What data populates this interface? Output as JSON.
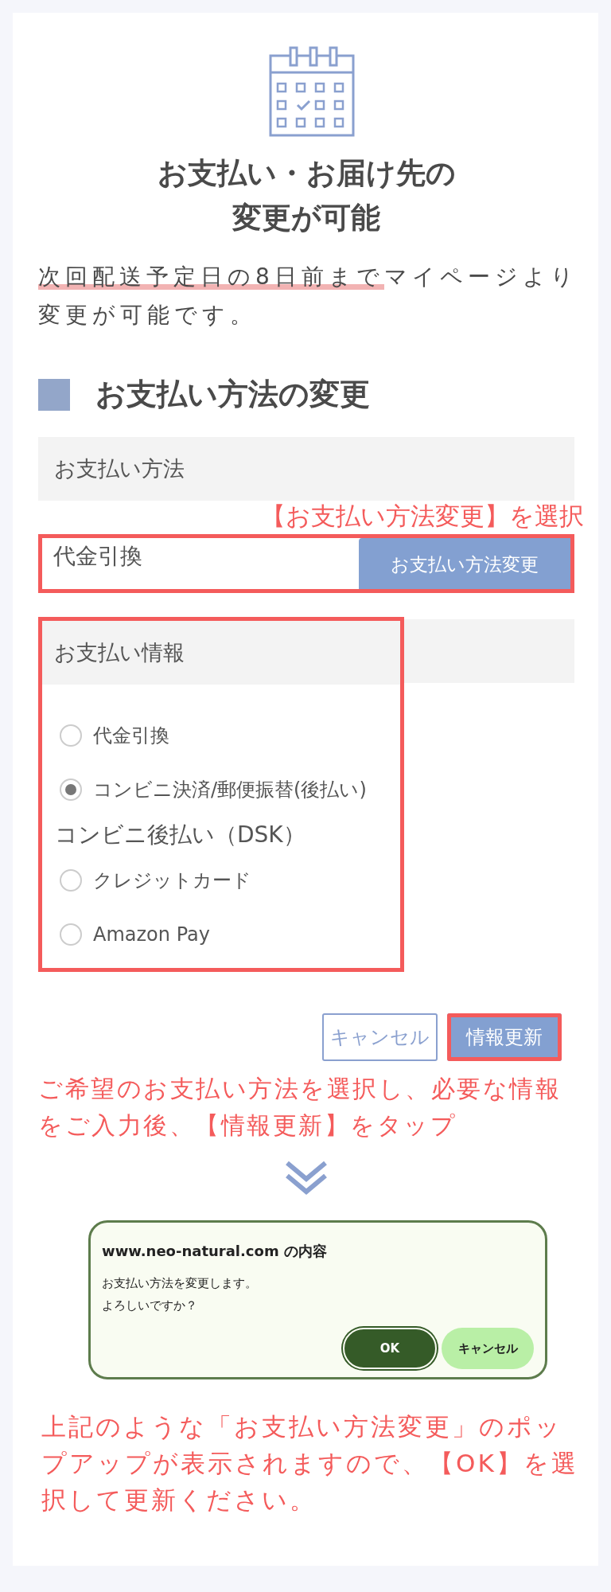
{
  "title_lines": [
    "お支払い・お届け先の",
    "変更が可能"
  ],
  "note": {
    "marked": "次回配送予定日の8日前まで",
    "rest": "マイページより変更が可能です。"
  },
  "section_heading": "お支払い方法の変更",
  "method": {
    "label": "お支払い方法",
    "annotation": "【お支払い方法変更】を選択",
    "value": "代金引換",
    "button": "お支払い方法変更",
    "highlighted": true
  },
  "payment_info": {
    "label": "お支払い情報",
    "highlighted": true,
    "options": [
      {
        "kind": "radio",
        "label": "代金引換",
        "selected": false
      },
      {
        "kind": "radio",
        "label": "コンビニ決済/郵便振替(後払い)",
        "selected": true
      },
      {
        "kind": "heading",
        "label": "コンビニ後払い（DSK）"
      },
      {
        "kind": "radio",
        "label": "クレジットカード",
        "selected": false
      },
      {
        "kind": "radio",
        "label": "Amazon Pay",
        "selected": false
      }
    ]
  },
  "actions": [
    {
      "kind": "outline",
      "label": "キャンセル",
      "highlighted": false
    },
    {
      "kind": "solid",
      "label": "情報更新",
      "highlighted": true
    }
  ],
  "instruction": "ご希望のお支払い方法を選択し、必要な情報をご入力後、【情報更新】をタップ",
  "dialog": {
    "title": "www.neo-natural.com の内容",
    "message_lines": [
      "お支払い方法を変更します。",
      "よろしいですか？"
    ],
    "buttons": [
      {
        "kind": "primary",
        "label": "OK"
      },
      {
        "kind": "secondary",
        "label": "キャンセル"
      }
    ]
  },
  "closing": "上記のような「お支払い方法変更」のポップアップが表示されますので、【OK】を選択して更新ください。"
}
